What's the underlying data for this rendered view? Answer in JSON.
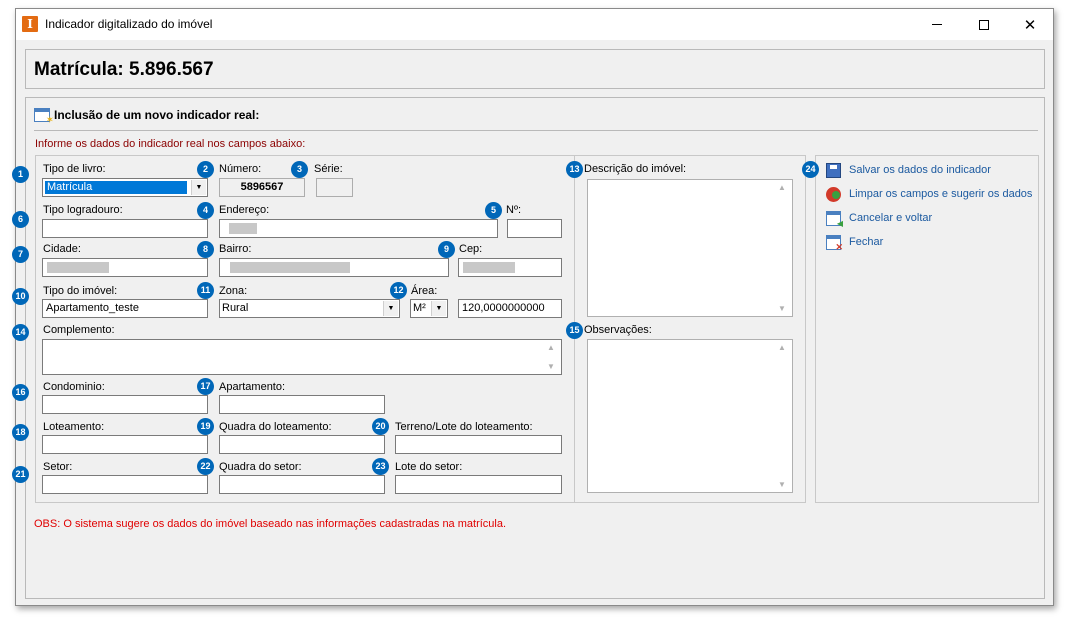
{
  "window": {
    "title": "Indicador digitalizado do imóvel",
    "app_icon_letter": "I"
  },
  "header": {
    "matricula": "Matrícula: 5.896.567"
  },
  "section": {
    "title": "Inclusão de um novo indicador real:",
    "hint": "Informe os dados do indicador real nos campos abaixo:"
  },
  "form": {
    "tipo_livro": {
      "badge": "1",
      "label": "Tipo de livro:",
      "value": "Matrícula"
    },
    "numero": {
      "badge": "2",
      "label": "Número:",
      "value": "5896567"
    },
    "serie": {
      "badge": "3",
      "label": "Série:",
      "value": ""
    },
    "no": {
      "badge": "5",
      "label": "Nº:",
      "value": ""
    },
    "endereco": {
      "badge": "4",
      "label": "Endereço:"
    },
    "tipo_logradouro": {
      "badge": "6",
      "label": "Tipo logradouro:",
      "value": ""
    },
    "cidade": {
      "badge": "7",
      "label": "Cidade:"
    },
    "bairro": {
      "badge": "8",
      "label": "Bairro:"
    },
    "cep": {
      "badge": "9",
      "label": "Cep:"
    },
    "tipo_imovel": {
      "badge": "10",
      "label": "Tipo do imóvel:",
      "value": "Apartamento_teste"
    },
    "zona": {
      "badge": "11",
      "label": "Zona:",
      "value": "Rural"
    },
    "area": {
      "badge": "12",
      "label": "Área:",
      "unit": "M²",
      "value": "120,0000000000"
    },
    "descricao": {
      "badge": "13",
      "label": "Descrição do imóvel:"
    },
    "complemento": {
      "badge": "14",
      "label": "Complemento:"
    },
    "observacoes": {
      "badge": "15",
      "label": "Observações:"
    },
    "condominio": {
      "badge": "16",
      "label": "Condominio:"
    },
    "apartamento": {
      "badge": "17",
      "label": "Apartamento:"
    },
    "loteamento": {
      "badge": "18",
      "label": "Loteamento:"
    },
    "quadra_loteamento": {
      "badge": "19",
      "label": "Quadra do loteamento:"
    },
    "terreno_lote": {
      "badge": "20",
      "label": "Terreno/Lote do loteamento:"
    },
    "setor": {
      "badge": "21",
      "label": "Setor:"
    },
    "quadra_setor": {
      "badge": "22",
      "label": "Quadra do setor:"
    },
    "lote_setor": {
      "badge": "23",
      "label": "Lote do setor:"
    }
  },
  "actions": {
    "badge": "24",
    "items": [
      {
        "label": "Salvar os dados do indicador",
        "icon": "save-icon"
      },
      {
        "label": "Limpar os campos e sugerir os dados",
        "icon": "clear-icon"
      },
      {
        "label": "Cancelar e voltar",
        "icon": "cancel-icon"
      },
      {
        "label": "Fechar",
        "icon": "close-window-icon"
      }
    ]
  },
  "footer": {
    "obs": "OBS: O sistema sugere os dados do imóvel baseado nas informações cadastradas na matrícula."
  },
  "colors": {
    "badge": "#0067b8",
    "link": "#1c5aa0",
    "warning": "#e00000",
    "hint": "#8b0000",
    "selection": "#0078d7"
  }
}
